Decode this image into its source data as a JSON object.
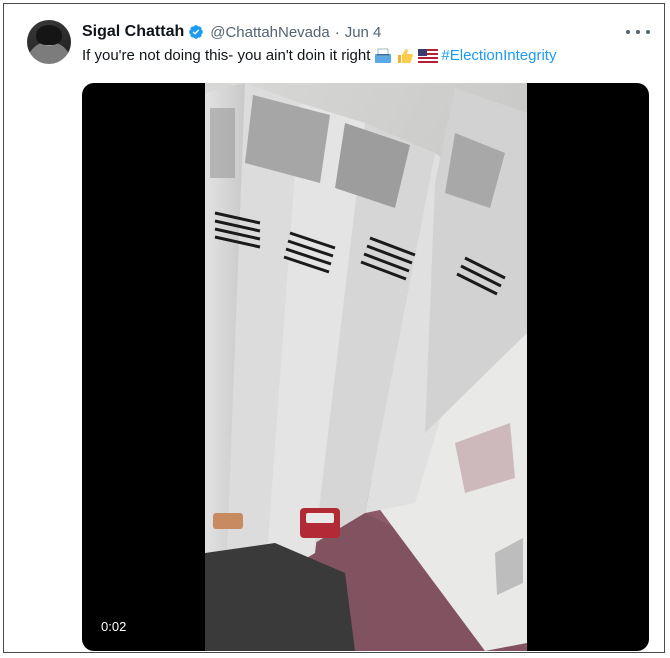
{
  "tweet": {
    "author_name": "Sigal Chattah",
    "handle": "@ChattahNevada",
    "separator": "·",
    "date": "Jun 4",
    "text": "If you're not doing this- you ain't doin it right",
    "hashtag": "#ElectionIntegrity",
    "emojis": [
      "ballot-box-icon",
      "thumbs-up-icon",
      "us-flag-icon"
    ],
    "more_icon": "more-horizontal-icon",
    "verified_icon": "verified-badge-icon"
  },
  "video": {
    "timestamp": "0:02"
  },
  "colors": {
    "accent": "#1d9bf0",
    "text_primary": "#0f1419",
    "text_secondary": "#536471",
    "media_background": "#000000"
  }
}
